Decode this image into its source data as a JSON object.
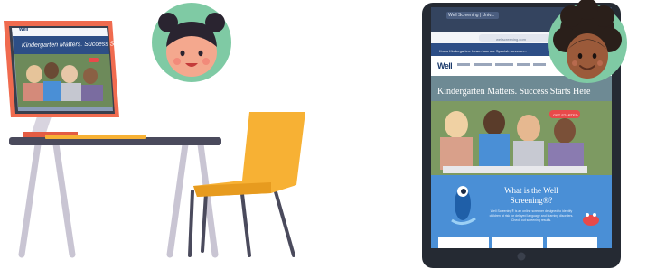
{
  "monitor_site": {
    "logo_text": "Well",
    "hero_text": "Kindergarten Matters. Success Starts Here."
  },
  "tablet_site": {
    "tab_title": "Well Screening | Univ...",
    "url": "wellscreening.com",
    "banner_text": "Know Kindergarten. Learn how our Spanish screener...",
    "logo_text": "Well",
    "hero_text": "Kindergarten Matters. Success Starts Here.",
    "cta_label": "GET STARTED",
    "section_title": "What is the Well Screening®?",
    "section_body": "Well Screening® is an online screener designed to identify children at risk for delayed language and learning disorders. Check out screening results."
  },
  "colors": {
    "monitor_frame": "#f06b4f",
    "desk": "#4a4a5c",
    "chair": "#f7b134",
    "tablet_frame": "#252a33",
    "avatar_bg": "#7fcaa4",
    "site_blue": "#2d4e86",
    "section_blue": "#4a8fd6"
  }
}
